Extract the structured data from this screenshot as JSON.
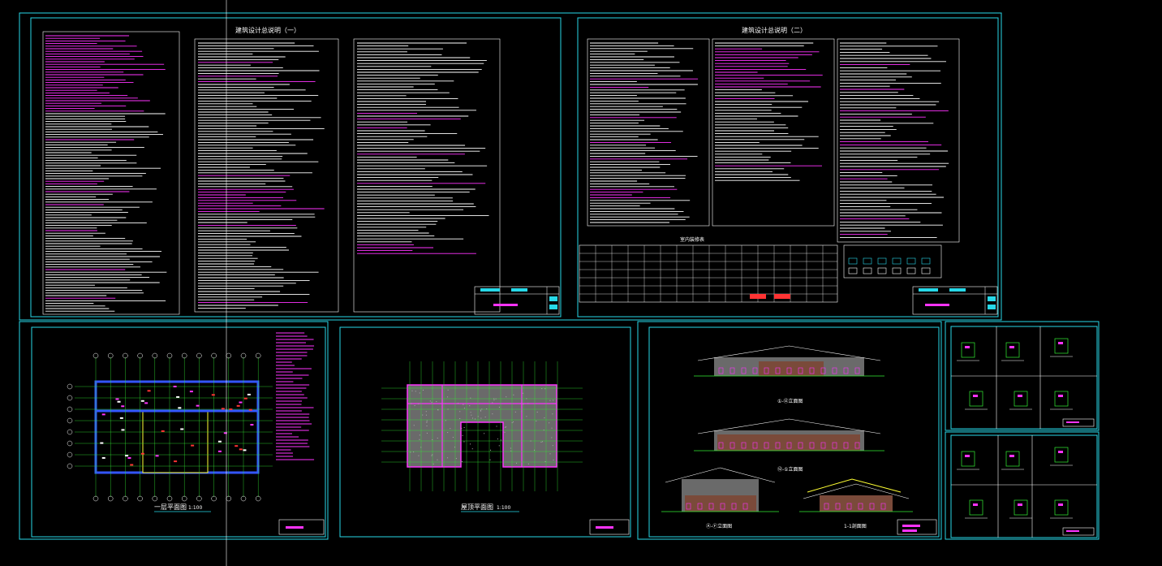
{
  "drawing": {
    "background": "#000000",
    "colors": {
      "frame": "#27d8e8",
      "text": "#ffffff",
      "highlight": "#ff33ff",
      "wall": "#3355ff",
      "green": "#33ee33",
      "red": "#ff3333",
      "yellow": "#ffff33",
      "roof": "#6a6a6a",
      "brick": "#7a4a3a"
    },
    "sheets": {
      "notes_1_title": "建筑设计总说明（一）",
      "notes_2_title": "建筑设计总说明（二）",
      "schedule_title": "室内装修表",
      "floor_plan_title": "一层平面图",
      "floor_plan_scale": "1:100",
      "roof_plan_title": "屋顶平面图",
      "roof_plan_scale": "1:100",
      "elev_1_title": "①-⑫立面图",
      "elev_2_title": "⑫-①立面图",
      "elev_3_title": "Ⓐ-Ⓕ立面图",
      "section_title": "1-1剖面图"
    }
  }
}
